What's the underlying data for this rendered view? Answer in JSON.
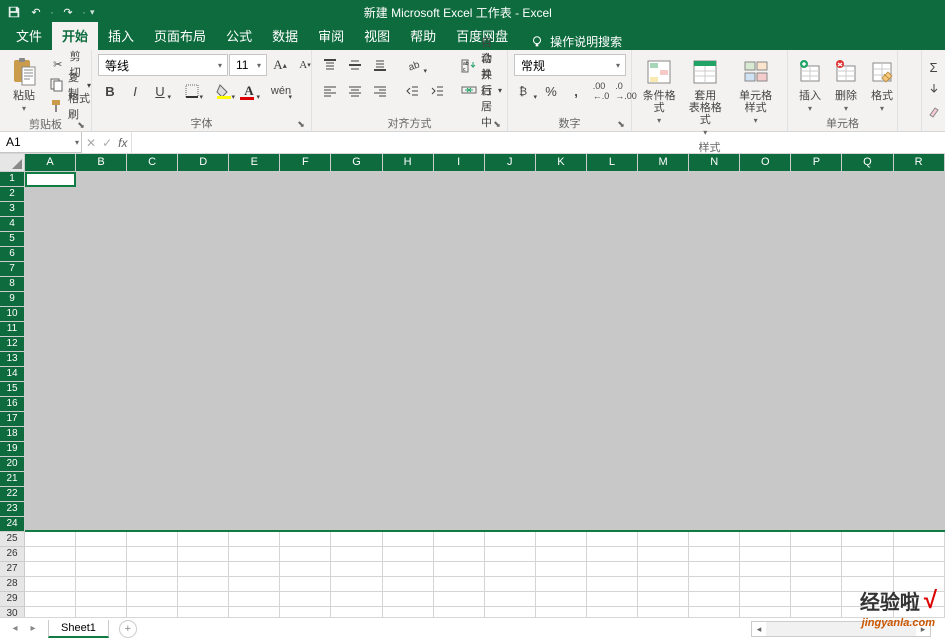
{
  "titlebar": {
    "title": "新建 Microsoft Excel 工作表 - Excel"
  },
  "tabs": {
    "items": [
      "文件",
      "开始",
      "插入",
      "页面布局",
      "公式",
      "数据",
      "审阅",
      "视图",
      "帮助",
      "百度网盘"
    ],
    "activeIndex": 1,
    "tellMe": "操作说明搜索"
  },
  "ribbon": {
    "clipboard": {
      "paste": "粘贴",
      "cut": "剪切",
      "copy": "复制",
      "formatPainter": "格式刷",
      "label": "剪贴板"
    },
    "font": {
      "name": "等线",
      "size": "11",
      "label": "字体"
    },
    "alignment": {
      "wrap": "自动换行",
      "merge": "合并后居中",
      "label": "对齐方式"
    },
    "number": {
      "format": "常规",
      "label": "数字"
    },
    "styles": {
      "conditional": "条件格式",
      "tableFormat": "套用\n表格格式",
      "cellStyles": "单元格样式",
      "label": "样式"
    },
    "cells": {
      "insert": "插入",
      "delete": "删除",
      "format": "格式",
      "label": "单元格"
    }
  },
  "formulaBar": {
    "cellRef": "A1",
    "formula": ""
  },
  "grid": {
    "cols": [
      "A",
      "B",
      "C",
      "D",
      "E",
      "F",
      "G",
      "H",
      "I",
      "J",
      "K",
      "L",
      "M",
      "N",
      "O",
      "P",
      "Q",
      "R"
    ],
    "rows": [
      "1",
      "2",
      "3",
      "4",
      "5",
      "6",
      "7",
      "8",
      "9",
      "10",
      "11",
      "12",
      "13",
      "14",
      "15",
      "16",
      "17",
      "18",
      "19",
      "20",
      "21",
      "22",
      "23",
      "24",
      "25",
      "26",
      "27",
      "28",
      "29",
      "30"
    ],
    "selRows": 24,
    "colWidthFirst": 51,
    "colWidth": 51.1
  },
  "sheetTabs": {
    "active": "Sheet1"
  },
  "watermark": {
    "text": "经验啦",
    "url": "jingyanla.com"
  }
}
